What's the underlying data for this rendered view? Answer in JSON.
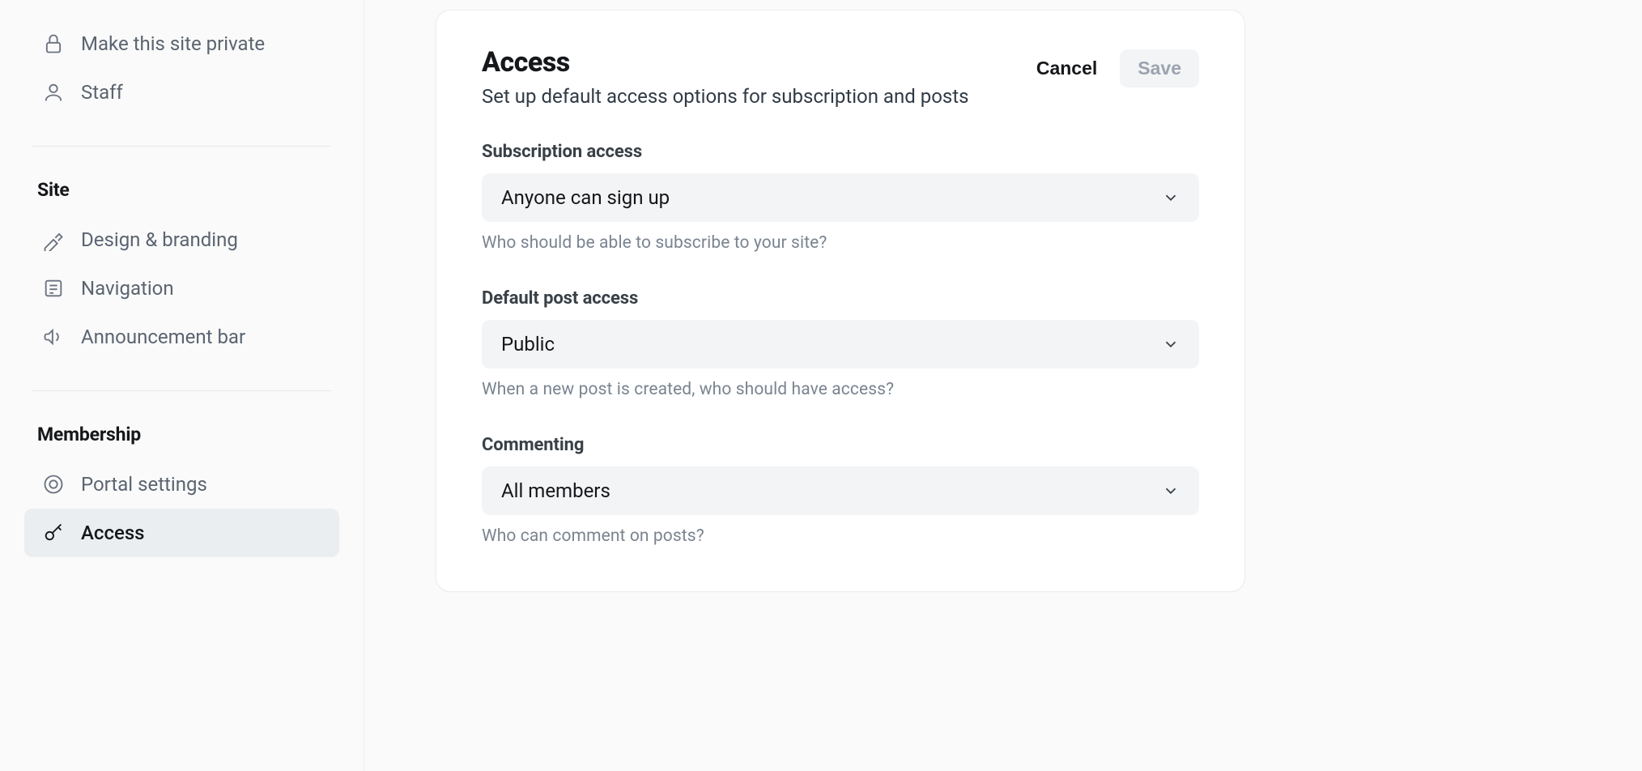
{
  "sidebar": {
    "items_top": [
      {
        "label": "Make this site private",
        "icon": "lock-icon"
      },
      {
        "label": "Staff",
        "icon": "staff-icon"
      }
    ],
    "section_site": "Site",
    "items_site": [
      {
        "label": "Design & branding",
        "icon": "palette-icon"
      },
      {
        "label": "Navigation",
        "icon": "list-icon"
      },
      {
        "label": "Announcement bar",
        "icon": "megaphone-icon"
      }
    ],
    "section_membership": "Membership",
    "items_membership": [
      {
        "label": "Portal settings",
        "icon": "portal-icon"
      },
      {
        "label": "Access",
        "icon": "key-icon",
        "active": true
      }
    ]
  },
  "card": {
    "title": "Access",
    "subtitle": "Set up default access options for subscription and posts",
    "cancel_label": "Cancel",
    "save_label": "Save",
    "fields": [
      {
        "label": "Subscription access",
        "value": "Anyone can sign up",
        "hint": "Who should be able to subscribe to your site?"
      },
      {
        "label": "Default post access",
        "value": "Public",
        "hint": "When a new post is created, who should have access?"
      },
      {
        "label": "Commenting",
        "value": "All members",
        "hint": "Who can comment on posts?"
      }
    ]
  }
}
